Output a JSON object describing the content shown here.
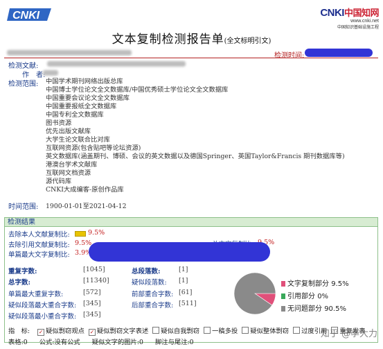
{
  "header": {
    "title": "文本复制检测报告单",
    "title_note": "(全文标明引文)",
    "cnki_url": "www.cnki.net",
    "cnki_sub": "中国知识基础设施工程"
  },
  "meta": {
    "detect_time_label": "检测时间:",
    "doc_label": "检测文献:",
    "author_label": "作　者:",
    "scope_label": "检测范围:",
    "timerange_label": "时间范围:",
    "timerange_value": "1900-01-01至2021-04-12"
  },
  "databases": [
    "中国学术期刊网络出版总库",
    "中国博士学位论文全文数据库/中国优秀硕士学位论文全文数据库",
    "中国重要会议论文全文数据库",
    "中国重要报纸全文数据库",
    "中国专利全文数据库",
    "图书资源",
    "优先出版文献库",
    "大学生论文联合比对库",
    "互联网资源(包含贴吧等论坛资源)",
    "英文数据库(涵盖期刊、博硕、会议的英文数据以及德国Springer、英国Taylor&Francis 期刊数据库等)",
    "港澳台学术文献库",
    "互联网文档资源",
    "源代码库",
    "CNKI大成编客-原创作品库"
  ],
  "results": {
    "section_title": "检测结果",
    "self_removed_label": "去除本人文献复制比:",
    "self_removed_value": "9.5%",
    "ref_removed_label": "去除引用文献复制比:",
    "ref_removed_value": "9.5%",
    "total_label": "总文字复制比:",
    "total_value": "9.5%",
    "single_max_label": "单篇最大文字复制比:",
    "single_max_value": "3.9%"
  },
  "stats": {
    "dup_chars_label": "重复字数:",
    "dup_chars_value": "[1045]",
    "total_paras_label": "总段落数:",
    "total_paras_value": "[1]",
    "total_chars_label": "总字数:",
    "total_chars_value": "[11340]",
    "sus_paras_label": "疑似段落数:",
    "sus_paras_value": "[1]",
    "single_max_dup_label": "单篇最大重复字数:",
    "single_max_dup_value": "[572]",
    "front_overlap_label": "前部重合字数:",
    "front_overlap_value": "[61]",
    "sus_max_overlap_label": "疑似段落最大重合字数:",
    "sus_max_overlap_value": "[345]",
    "back_overlap_label": "后部重合字数:",
    "back_overlap_value": "[511]",
    "sus_min_overlap_label": "疑似段落最小重合字数:",
    "sus_min_overlap_value": "[345]"
  },
  "chart_data": {
    "type": "pie",
    "slices": [
      {
        "label": "文字复制部分",
        "value": 9.5,
        "color": "#e0507a"
      },
      {
        "label": "引用部分",
        "value": 0,
        "color": "#3aa85a"
      },
      {
        "label": "无问题部分",
        "value": 90.5,
        "color": "#8a8a8a"
      }
    ],
    "legend_values": [
      "9.5%",
      "0%",
      "90.5%"
    ]
  },
  "indicators": {
    "label": "指　标:",
    "items": [
      {
        "text": "疑似剽窃观点",
        "checked": true
      },
      {
        "text": "疑似剽窃文字表述",
        "checked": true
      },
      {
        "text": "疑似自我剽窃",
        "checked": false
      },
      {
        "text": "一稿多投",
        "checked": false
      },
      {
        "text": "疑似整体剽窃",
        "checked": false
      },
      {
        "text": "过度引用",
        "checked": false
      },
      {
        "text": "重复发表",
        "checked": false
      }
    ]
  },
  "footer": {
    "tables": "表格:0",
    "formulas": "公式:没有公式",
    "figures": "疑似文字的图片:0",
    "footnotes": "脚注与尾注:0"
  },
  "watermark": "知乎 @李大力",
  "colors": {
    "accent_red": "#b42121",
    "label_blue": "#1a3b8a",
    "result_green": "#d7ecd2",
    "percent_red": "#c21a1a"
  }
}
